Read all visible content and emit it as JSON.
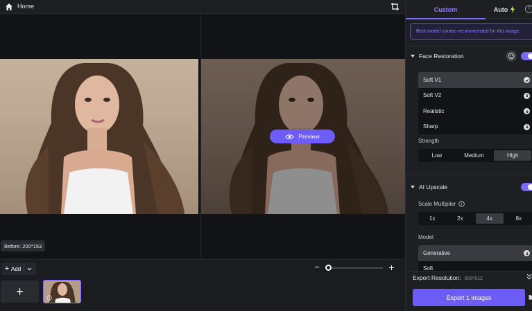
{
  "topbar": {
    "home_label": "Home"
  },
  "canvas": {
    "preview_label": "Preview",
    "before_badge": "Before: 200*153"
  },
  "bottom": {
    "add_label": "Add",
    "add_plus": "+",
    "zoom_minus": "−",
    "zoom_plus": "+",
    "add_tile_plus": "+",
    "zoom_level": 0
  },
  "panel": {
    "tabs": {
      "custom": "Custom",
      "auto": "Auto"
    },
    "hint": "Best model combo recommended for this image.",
    "face_restoration": {
      "title": "Face Restoration",
      "enabled": true,
      "models": [
        {
          "label": "Soft V1",
          "selected": true,
          "icon": "check-icon"
        },
        {
          "label": "Soft V2",
          "selected": false,
          "icon": "download-icon"
        },
        {
          "label": "Realistic",
          "selected": false,
          "icon": "download-icon"
        },
        {
          "label": "Sharp",
          "selected": false,
          "icon": "download-icon"
        }
      ],
      "strength_label": "Strength",
      "strength_options": [
        "Low",
        "Medium",
        "High"
      ],
      "strength_selected": "High"
    },
    "ai_upscale": {
      "title": "AI Upscale",
      "enabled": true,
      "scale_label": "Scale Multiplier",
      "scale_options": [
        "1x",
        "2x",
        "4x",
        "8x"
      ],
      "scale_selected": "4x",
      "model_label": "Model",
      "models": [
        {
          "label": "Generative",
          "selected": true,
          "icon": "download-icon"
        },
        {
          "label": "Soft",
          "selected": false
        }
      ]
    },
    "export": {
      "resolution_label": "Export Resolution:",
      "resolution_value": "800*612",
      "button_label": "Export 1 images"
    }
  },
  "colors": {
    "accent": "#6d5cf6",
    "accent_text": "#8f7bff",
    "panel_bg": "#1e1f23"
  }
}
